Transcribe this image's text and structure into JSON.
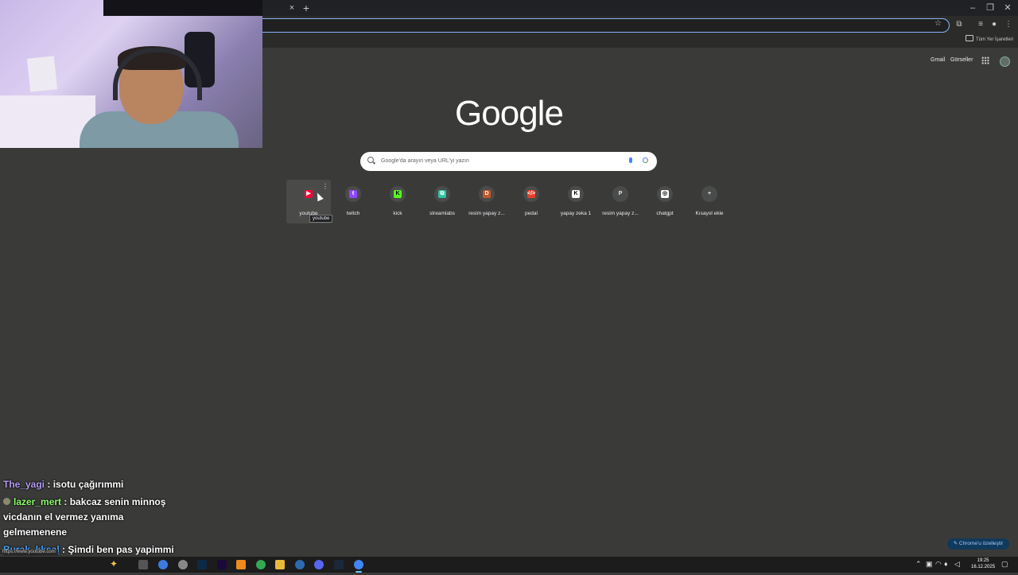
{
  "browser": {
    "tab_close_glyph": "×",
    "new_tab_glyph": "+",
    "bookmarks_all": "Tüm Yer İşaretleri"
  },
  "google": {
    "header_links": [
      "Gmail",
      "Görseller"
    ],
    "logo": "Google",
    "search_placeholder": "Google'da arayın veya URL'yi yazın",
    "shortcuts": [
      {
        "label": "youtube",
        "favicon": "▶",
        "color": "#ff0033",
        "fg": "#ffffff"
      },
      {
        "label": "twitch",
        "favicon": "t",
        "color": "#9146ff",
        "fg": "#ffffff"
      },
      {
        "label": "kick",
        "favicon": "K",
        "color": "#53fc18",
        "fg": "#000000"
      },
      {
        "label": "streamlabs",
        "favicon": "⧉",
        "color": "#31c3a2",
        "fg": "#ffffff"
      },
      {
        "label": "resim yapay z...",
        "favicon": "D",
        "color": "#c4572b",
        "fg": "#ffffff"
      },
      {
        "label": "pedal",
        "favicon": "</>",
        "color": "#e63f2b",
        "fg": "#ffffff"
      },
      {
        "label": "yapay zeka 1",
        "favicon": "K",
        "color": "#ffffff",
        "fg": "#000000"
      },
      {
        "label": "resim yapay z...",
        "favicon": "P",
        "color": "#4a4c4b",
        "fg": "#e8eaed"
      },
      {
        "label": "chatgpt",
        "favicon": "◎",
        "color": "#ffffff",
        "fg": "#000000"
      },
      {
        "label": "Kısayol ekle",
        "favicon": "+",
        "color": "#4a4c4b",
        "fg": "#e8eaed"
      }
    ],
    "tooltip": "youtube",
    "customize_button": "Chrome'u özelleştir",
    "status_url": "https://www.youtube.com"
  },
  "chat": [
    {
      "user": "The_yagi",
      "text": "isotu çağırımmi",
      "badge": false
    },
    {
      "user": "lazer_mert",
      "text": "bakcaz senin minnoş vicdanın el vermez yanıma gelmemenene",
      "badge": true
    },
    {
      "user": "Burak_kksal",
      "text": "Şimdi ben pas yapimmi yapmiyimmi",
      "badge": false
    }
  ],
  "taskbar": {
    "clock_time": "19:25",
    "clock_date": "16.12.2025"
  }
}
